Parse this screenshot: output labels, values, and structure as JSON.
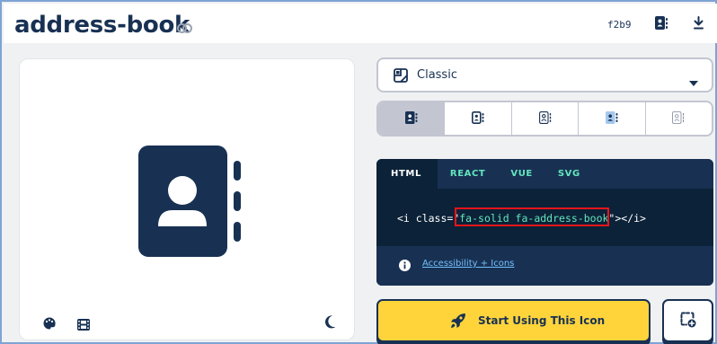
{
  "header": {
    "title": "address-book",
    "unicode": "f2b9",
    "icons": [
      "link-icon",
      "address-book-icon",
      "download-icon"
    ]
  },
  "preview": {
    "icon": "address-book-icon",
    "controls": [
      "palette-icon",
      "film-icon",
      "moon-icon"
    ]
  },
  "style_select": {
    "selected": "Classic",
    "icon": "classic-style-icon"
  },
  "variants": [
    {
      "name": "solid",
      "active": true
    },
    {
      "name": "regular",
      "active": false
    },
    {
      "name": "light",
      "active": false
    },
    {
      "name": "duotone",
      "active": false
    },
    {
      "name": "thin",
      "active": false
    }
  ],
  "code": {
    "tabs": [
      "HTML",
      "REACT",
      "VUE",
      "SVG"
    ],
    "active_tab": "HTML",
    "open": "<i class=\"",
    "class_value": "fa-solid fa-address-book",
    "close": "\"></i>",
    "a11y_link": "Accessibility + Icons"
  },
  "cta": {
    "start_label": "Start Using This Icon"
  },
  "colors": {
    "navy": "#183153",
    "yellow": "#ffd43b",
    "teal": "#63e6be",
    "highlight": "#e8151b"
  }
}
